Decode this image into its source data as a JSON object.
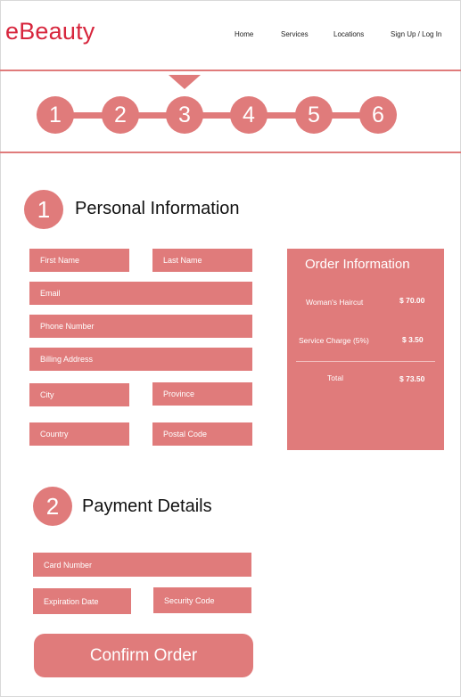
{
  "brand": {
    "logo": "eBeauty",
    "accent": "#e07b7b",
    "logo_color": "#d7263d"
  },
  "nav": {
    "home": "Home",
    "services": "Services",
    "locations": "Locations",
    "signup": "Sign Up / Log In"
  },
  "progress": {
    "current_step": 3,
    "steps": [
      "1",
      "2",
      "3",
      "4",
      "5",
      "6"
    ]
  },
  "personal": {
    "number": "1",
    "title": "Personal Information",
    "placeholders": {
      "first_name": "First Name",
      "last_name": "Last Name",
      "email": "Email",
      "phone": "Phone Number",
      "billing": "Billing Address",
      "city": "City",
      "province": "Province",
      "country": "Country",
      "postal": "Postal Code"
    }
  },
  "order": {
    "title": "Order Information",
    "item_label": "Woman's Haircut",
    "item_value": "$ 70.00",
    "charge_label": "Service Charge (5%)",
    "charge_value": "$ 3.50",
    "total_label": "Total",
    "total_value": "$ 73.50"
  },
  "payment": {
    "number": "2",
    "title": "Payment Details",
    "placeholders": {
      "card": "Card Number",
      "expiry": "Expiration Date",
      "security": "Security Code"
    }
  },
  "confirm_label": "Confirm Order"
}
